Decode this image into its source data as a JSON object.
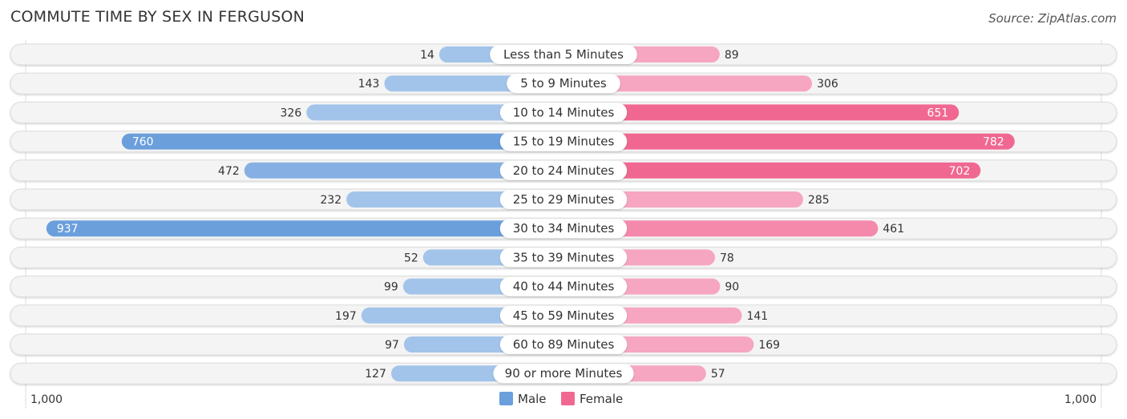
{
  "chart_data": {
    "type": "bar",
    "orientation": "horizontal-diverging",
    "title": "COMMUTE TIME BY SEX IN FERGUSON",
    "source": "Source: ZipAtlas.com",
    "categories": [
      "Less than 5 Minutes",
      "5 to 9 Minutes",
      "10 to 14 Minutes",
      "15 to 19 Minutes",
      "20 to 24 Minutes",
      "25 to 29 Minutes",
      "30 to 34 Minutes",
      "35 to 39 Minutes",
      "40 to 44 Minutes",
      "45 to 59 Minutes",
      "60 to 89 Minutes",
      "90 or more Minutes"
    ],
    "series": [
      {
        "name": "Male",
        "color": "#6a9fdc",
        "values": [
          14,
          143,
          326,
          760,
          472,
          232,
          937,
          52,
          99,
          197,
          97,
          127
        ]
      },
      {
        "name": "Female",
        "color": "#f06892",
        "values": [
          89,
          306,
          651,
          782,
          702,
          285,
          461,
          78,
          90,
          141,
          169,
          57
        ]
      }
    ],
    "axis": {
      "left_label": "1,000",
      "right_label": "1,000",
      "max": 1000
    },
    "legend": {
      "position": "bottom-center",
      "items": [
        "Male",
        "Female"
      ]
    }
  }
}
